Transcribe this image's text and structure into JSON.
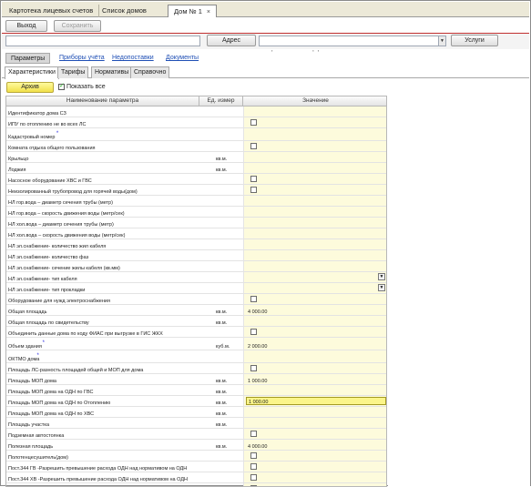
{
  "tabs": [
    {
      "label": "Картотека лицевых счетов"
    },
    {
      "label": "Список домов"
    },
    {
      "label": "Дом № 1",
      "close": "×"
    }
  ],
  "toolbar": {
    "exit_label": "Выход",
    "save_label": "Сохранить"
  },
  "address": {
    "search_value": "",
    "button_label": "Адрес",
    "address_value": ",                        ,  ,",
    "services_label": "Услуги"
  },
  "link_tabs": [
    "Параметры",
    "Приборы учёта",
    "Недопоставки",
    "Документы"
  ],
  "sub_tabs": [
    "Характеристики",
    "Тарифы",
    "Нормативы",
    "Справочно"
  ],
  "archive": {
    "button_label": "Архив",
    "show_all_label": "Показать все",
    "show_all_checked": true
  },
  "grid": {
    "headers": {
      "name": "Наименование параметра",
      "unit": "Ед. измер",
      "value": "Значение"
    },
    "rows": [
      {
        "name": "Идентификатор дома СЗ",
        "unit": "",
        "type": "text",
        "value": ""
      },
      {
        "name": "ИПУ по отоплению не во всех ЛС",
        "unit": "",
        "type": "checkbox",
        "value": ""
      },
      {
        "name": "Кадастровый номер",
        "req": "*",
        "unit": "",
        "type": "text",
        "value": ""
      },
      {
        "name": "Комната отдыха общего пользования",
        "unit": "",
        "type": "checkbox",
        "value": ""
      },
      {
        "name": "Крыльцо",
        "unit": "кв.м.",
        "type": "text",
        "value": ""
      },
      {
        "name": "Лоджия",
        "unit": "кв.м.",
        "type": "text",
        "value": ""
      },
      {
        "name": "Насосное оборудование ХВС и ГВС",
        "unit": "",
        "type": "checkbox",
        "value": ""
      },
      {
        "name": "Неизолированный трубопровод для горячей воды(дом)",
        "unit": "",
        "type": "checkbox",
        "value": ""
      },
      {
        "name": "НЛ гор.вода – диаметр сечения трубы (метр)",
        "unit": "",
        "type": "text",
        "value": ""
      },
      {
        "name": "НЛ гор.вода – скорость движения воды (метр/сек)",
        "unit": "",
        "type": "text",
        "value": ""
      },
      {
        "name": "НЛ хол.вода – диаметр сечения трубы (метр)",
        "unit": "",
        "type": "text",
        "value": ""
      },
      {
        "name": "НЛ хол.вода – скорость движения воды (метр/сек)",
        "unit": "",
        "type": "text",
        "value": ""
      },
      {
        "name": "НЛ эл.снабжение- количество жил кабеля",
        "unit": "",
        "type": "text",
        "value": ""
      },
      {
        "name": "НЛ эл.снабжение- количество фаз",
        "unit": "",
        "type": "text",
        "value": ""
      },
      {
        "name": "НЛ эл.снабжение- сечение жилы кабеля (кв.мм)",
        "unit": "",
        "type": "text",
        "value": ""
      },
      {
        "name": "НЛ эл.снабжение- тип кабеля",
        "unit": "",
        "type": "dropdown",
        "value": ""
      },
      {
        "name": "НЛ эл.снабжение- тип прокладки",
        "unit": "",
        "type": "dropdown",
        "value": ""
      },
      {
        "name": "Оборудование для нужд электроснабжения",
        "unit": "",
        "type": "checkbox",
        "value": ""
      },
      {
        "name": "Общая площадь",
        "unit": "кв.м.",
        "type": "text",
        "value": "4 000.00"
      },
      {
        "name": "Общая площадь по свидетельству",
        "unit": "кв.м.",
        "type": "text",
        "value": ""
      },
      {
        "name": "Объединить данные дома по коду ФИАС при выгрузке в ГИС ЖКХ",
        "unit": "",
        "type": "checkbox",
        "value": ""
      },
      {
        "name": "Объем здания",
        "req": "*",
        "unit": "куб.м.",
        "type": "text",
        "value": "2 000.00"
      },
      {
        "name": "ОКТМО дома",
        "req": "*",
        "unit": "",
        "type": "text",
        "value": ""
      },
      {
        "name": "Площадь ЛС-разность площадей общей и МОП для дома",
        "unit": "",
        "type": "checkbox",
        "value": ""
      },
      {
        "name": "Площадь МОП дома",
        "unit": "кв.м.",
        "type": "text",
        "value": "1 000.00"
      },
      {
        "name": "Площадь МОП дома на ОДН по ГВС",
        "unit": "кв.м.",
        "type": "text",
        "value": ""
      },
      {
        "name": "Площадь МОП дома на ОДН по Отоплению",
        "unit": "кв.м.",
        "type": "selected",
        "value": "1 000.00"
      },
      {
        "name": "Площадь МОП дома на ОДН по ХВС",
        "unit": "кв.м.",
        "type": "text",
        "value": ""
      },
      {
        "name": "Площадь участка",
        "unit": "кв.м.",
        "type": "text",
        "value": ""
      },
      {
        "name": "Подземная автостоянка",
        "unit": "",
        "type": "checkbox",
        "value": ""
      },
      {
        "name": "Полезная площадь",
        "unit": "кв.м.",
        "type": "text",
        "value": "4 000.00"
      },
      {
        "name": "Полотенцесушитель(дом)",
        "unit": "",
        "type": "checkbox",
        "value": ""
      },
      {
        "name": "Пост.344 ГВ -Разрешить превышение расхода ОДН над нормативом на ОДН",
        "unit": "",
        "type": "checkbox",
        "value": ""
      },
      {
        "name": "Пост.344 ХВ -Разрешить превышение расхода ОДН над нормативом на ОДН",
        "unit": "",
        "type": "checkbox",
        "value": ""
      },
      {
        "name": "Пост.344 ЭЭ -Разрешить превышение расхода ОДН над нормативом на ОДН",
        "unit": "",
        "type": "checkbox",
        "value": ""
      }
    ]
  }
}
